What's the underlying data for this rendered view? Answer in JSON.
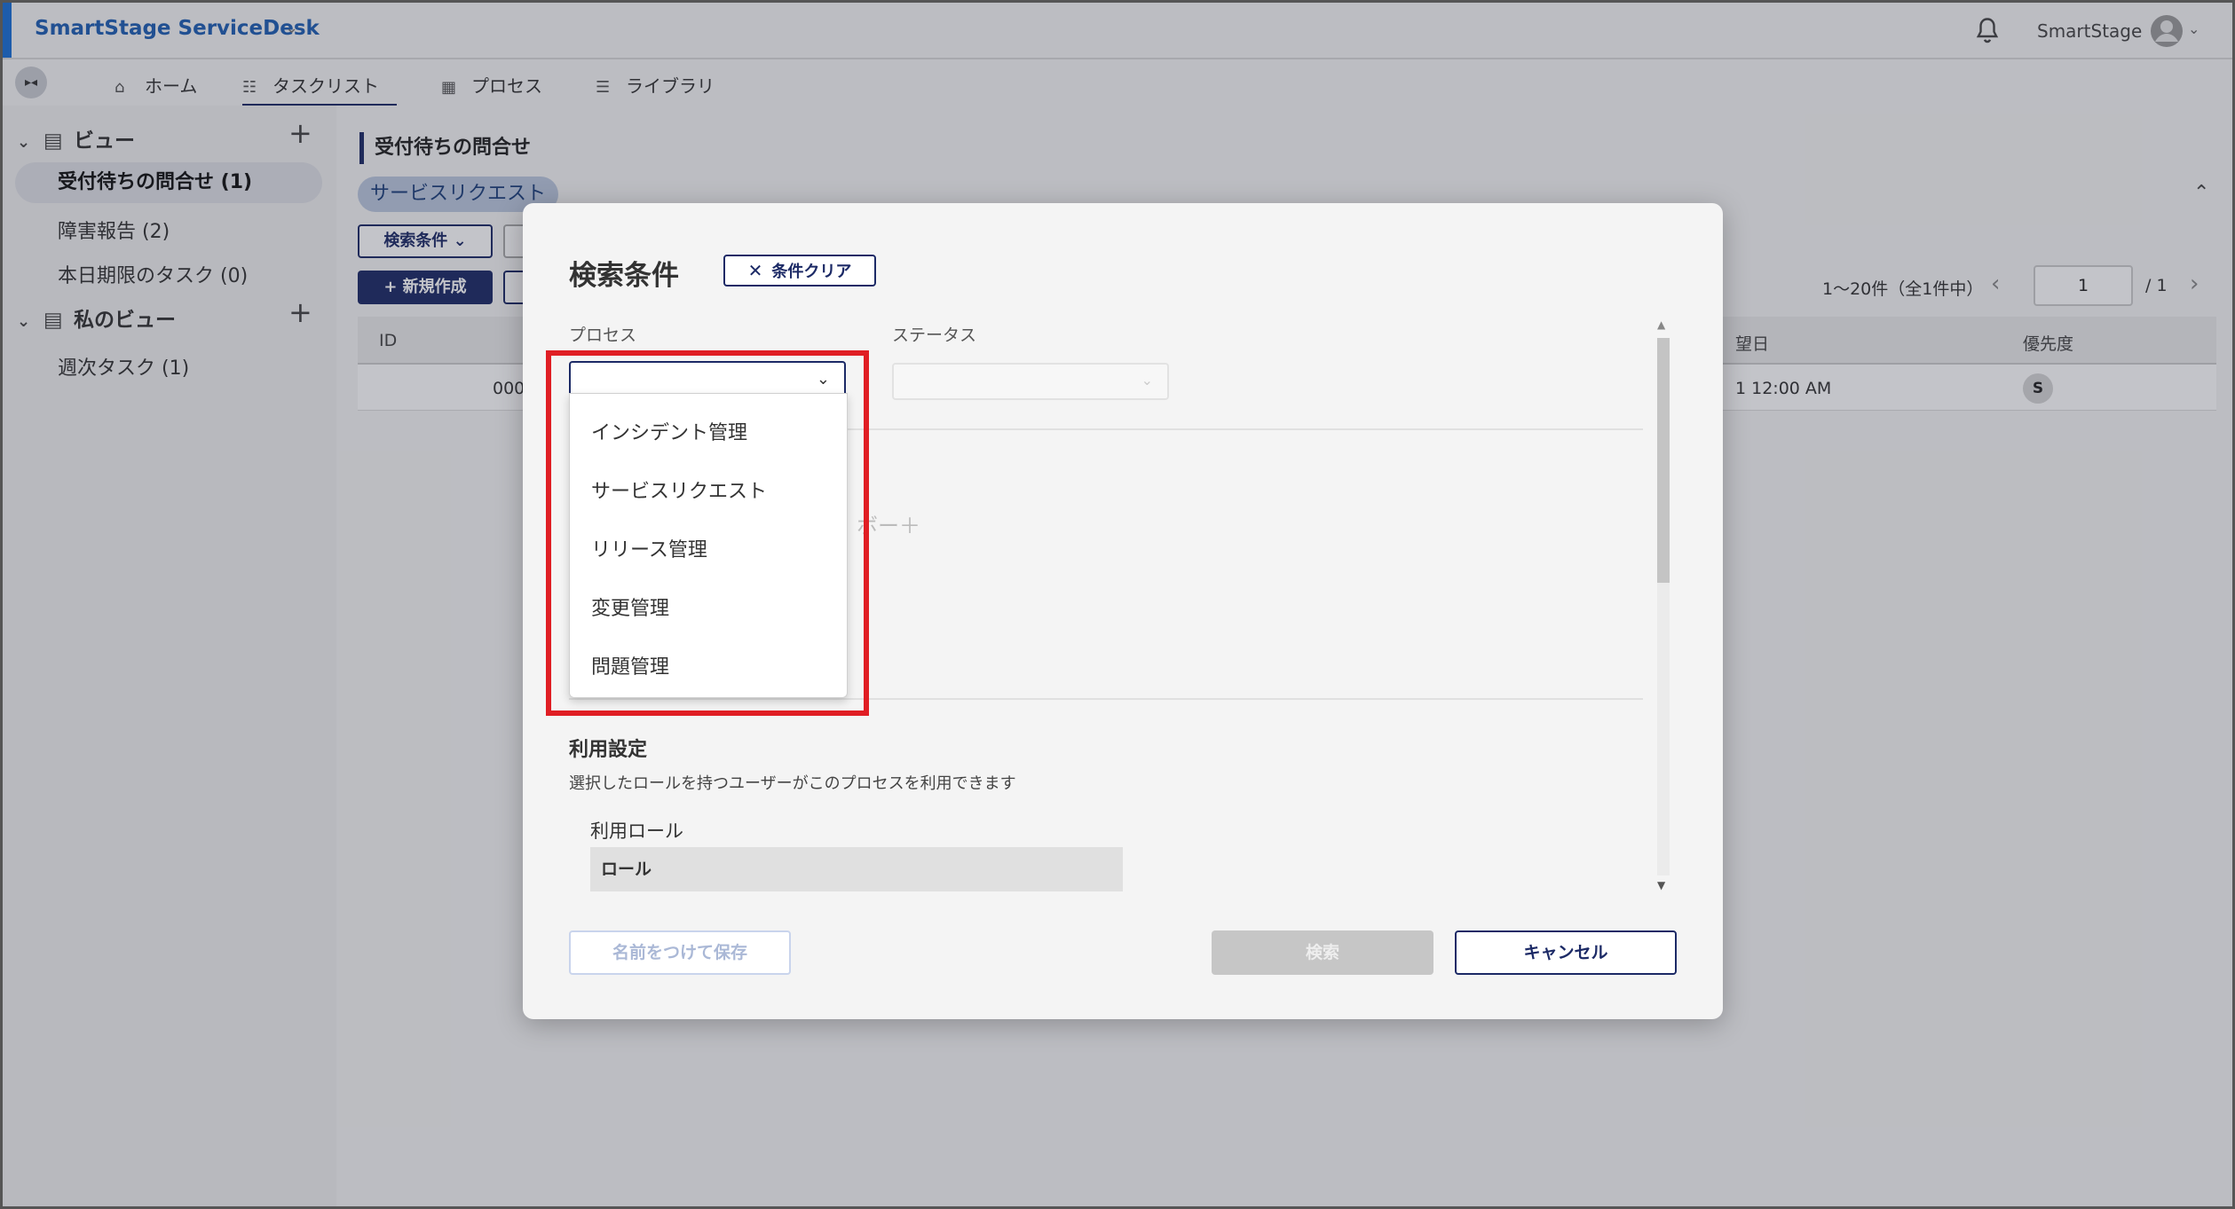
{
  "header": {
    "app_title": "SmartStage ServiceDesk",
    "app_caret": "⌄",
    "user_name": "SmartStage",
    "avatar_caret": "⌄"
  },
  "nav": {
    "collapse_icon": "▸◂",
    "tabs": [
      {
        "label": "ホーム",
        "icon": "⌂"
      },
      {
        "label": "タスクリスト",
        "icon": "☷"
      },
      {
        "label": "プロセス",
        "icon": "▦"
      },
      {
        "label": "ライブラリ",
        "icon": "☰"
      }
    ]
  },
  "sidebar": {
    "group1_label": "ビュー",
    "group1_items": [
      "受付待ちの問合せ (1)",
      "障害報告 (2)",
      "本日期限のタスク (0)"
    ],
    "group2_label": "私のビュー",
    "group2_items": [
      "週次タスク (1)"
    ],
    "plus": "+",
    "chev": "⌄",
    "doc": "▤"
  },
  "main": {
    "page_title": "受付待ちの問合せ",
    "chip": "サービスリクエスト",
    "filter_button": "検索条件 ⌄",
    "new_button": "+ 新規作成",
    "collapse_up": "⌃",
    "pager_text": "1〜20件（全1件中）",
    "pager_prev": "‹",
    "pager_page": "1",
    "pager_total": "/ 1",
    "pager_next": "›",
    "columns": [
      "ID",
      "望日",
      "優先度"
    ],
    "row": {
      "id": "000(",
      "date": "1 12:00 AM",
      "priority": "S"
    }
  },
  "modal": {
    "title": "検索条件",
    "clear_button": "条件クリア",
    "clear_icon": "✕",
    "process_label": "プロセス",
    "status_label": "ステータス",
    "select_chev": "⌄",
    "faint_text": "ボー＋",
    "usage_title": "利用設定",
    "usage_desc": "選択したロールを持つユーザーがこのプロセスを利用できます",
    "role_label": "利用ロール",
    "role_column": "ロール",
    "scroll_up": "▲",
    "scroll_down": "▼",
    "save_button": "名前をつけて保存",
    "search_button": "検索",
    "cancel_button": "キャンセル"
  },
  "dropdown": {
    "options": [
      "インシデント管理",
      "サービスリクエスト",
      "リリース管理",
      "変更管理",
      "問題管理"
    ]
  }
}
